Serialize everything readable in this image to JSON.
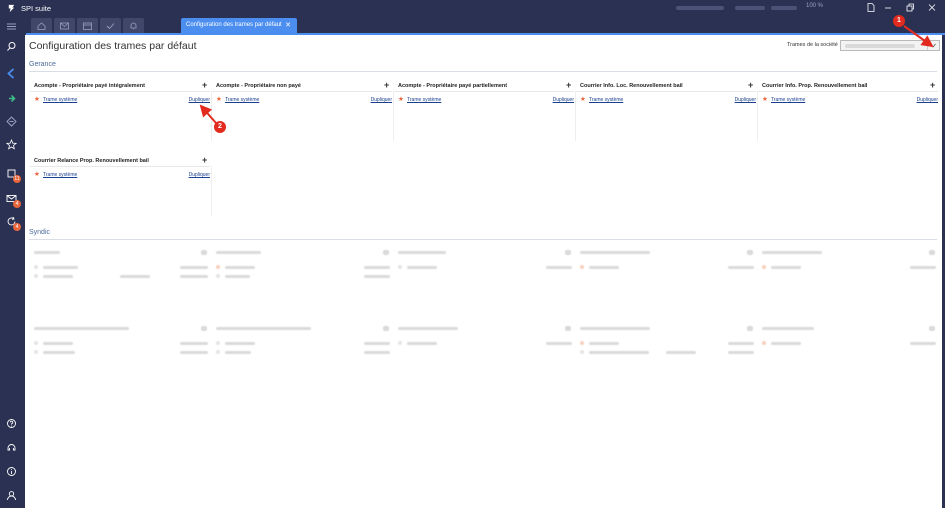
{
  "app": {
    "title": "SPI suite",
    "zoom_label": "100 %"
  },
  "tabs": {
    "active_label": "Configuration des trames par défaut",
    "close_glyph": "✕"
  },
  "page": {
    "title": "Configuration des trames par défaut",
    "company_label": "Trames de la société"
  },
  "sidebar": {
    "badges": [
      "11",
      "4",
      "4"
    ]
  },
  "sections": {
    "gerance": {
      "title": "Gerance",
      "cards": [
        {
          "title": "Acompte - Propriétaire payé intégralement",
          "row_label": "Trame système",
          "row_action": "Dupliquer"
        },
        {
          "title": "Acompte - Propriétaire non payé",
          "row_label": "Trame système",
          "row_action": "Dupliquer"
        },
        {
          "title": "Acompte - Propriétaire payé partiellement",
          "row_label": "Trame système",
          "row_action": "Dupliquer"
        },
        {
          "title": "Courrier Info. Loc. Renouvellement bail",
          "row_label": "Trame système",
          "row_action": "Dupliquer"
        },
        {
          "title": "Courrier Info. Prop. Renouvellement bail",
          "row_label": "Trame système",
          "row_action": "Dupliquer"
        },
        {
          "title": "Courrier Relance Prop. Renouvellement bail",
          "row_label": "Trame système",
          "row_action": "Dupliquer"
        }
      ],
      "add_glyph": "+"
    },
    "syndic": {
      "title": "Syndic"
    }
  },
  "annotations": [
    "1",
    "2"
  ],
  "colors": {
    "titlebar": "#2b3152",
    "accent": "#4b8ef0",
    "star": "#e8663b",
    "link": "#1a3f8f",
    "annotation": "#e22b1e"
  }
}
